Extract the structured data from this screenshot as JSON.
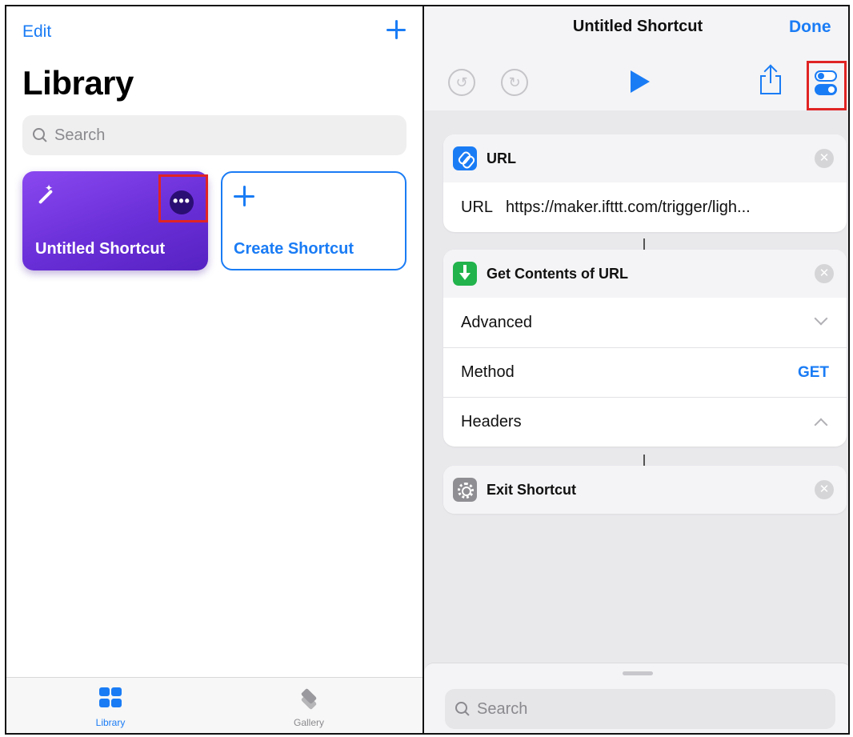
{
  "library": {
    "edit_label": "Edit",
    "title": "Library",
    "search_placeholder": "Search",
    "cards": {
      "untitled_label": "Untitled Shortcut",
      "more_label": "•••",
      "create_label": "Create Shortcut"
    },
    "tabs": {
      "library": "Library",
      "gallery": "Gallery"
    }
  },
  "editor": {
    "title": "Untitled Shortcut",
    "done_label": "Done",
    "undo_glyph": "↺",
    "redo_glyph": "↻",
    "actions": {
      "url": {
        "name": "URL",
        "row_key": "URL",
        "row_value": "https://maker.ifttt.com/trigger/ligh..."
      },
      "get_contents": {
        "name": "Get Contents of URL",
        "advanced": "Advanced",
        "method": "Method",
        "method_value": "GET",
        "headers": "Headers"
      },
      "exit": {
        "name": "Exit Shortcut"
      }
    },
    "remove_glyph": "✕",
    "bottom_search_placeholder": "Search"
  },
  "colors": {
    "accent": "#1a7cf5",
    "highlight": "#e02424",
    "card_purple": "#6a2fd8",
    "green_action": "#22b34c"
  }
}
